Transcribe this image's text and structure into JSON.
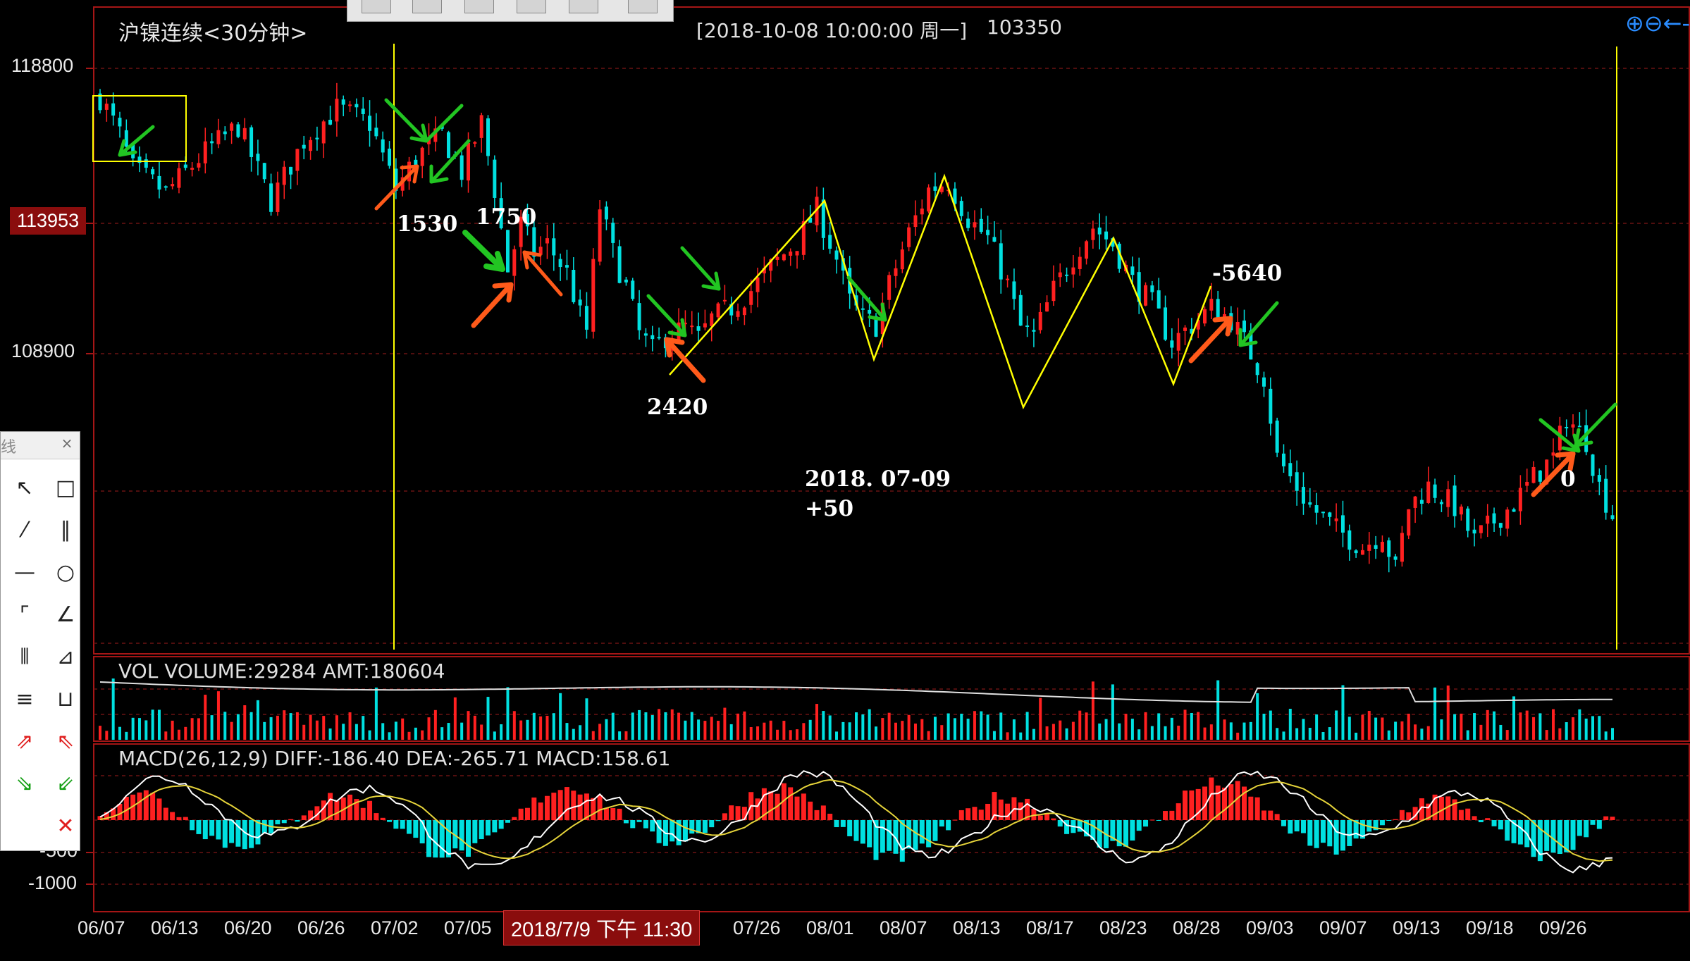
{
  "chart_title": "沪镍连续<30分钟>",
  "cursor_info": {
    "datetime": "[2018-10-08  10:00:00 周一]",
    "value": "103350"
  },
  "price_axis": {
    "labels": [
      "118800",
      "108900"
    ],
    "current_price": "113953"
  },
  "annotations": {
    "a1": "1530",
    "a2": "1750",
    "a3": "2420",
    "a4": "-5640",
    "a5": "0",
    "a6_line1": "2018. 07-09",
    "a6_line2": "+50"
  },
  "volume_panel": {
    "header": "VOL  VOLUME:29284 AMT:180604"
  },
  "macd_panel": {
    "header": "MACD(26,12,9)  DIFF:-186.40 DEA:-265.71 MACD:158.61",
    "axis_labels": [
      "-500",
      "-1000"
    ]
  },
  "date_axis": [
    "06/07",
    "06/13",
    "06/20",
    "06/26",
    "07/02",
    "07/05",
    "07/26",
    "08/01",
    "08/07",
    "08/13",
    "08/17",
    "08/23",
    "08/28",
    "09/03",
    "09/07",
    "09/13",
    "09/18",
    "09/26"
  ],
  "cursor_date_label": "2018/7/9 下午 11:30",
  "toolbox": {
    "title": "线"
  },
  "colors": {
    "up": "#ff2020",
    "down": "#00e0e0",
    "zigzag": "#ffff00",
    "green_arrow": "#22c522",
    "orange_arrow": "#ff5a1a"
  },
  "chart_data": {
    "type": "candlestick",
    "price_waypoints": [
      [
        0,
        117800
      ],
      [
        3,
        116500
      ],
      [
        5,
        115300
      ],
      [
        10,
        114500
      ],
      [
        16,
        115900
      ],
      [
        21,
        116800
      ],
      [
        26,
        114200
      ],
      [
        31,
        116300
      ],
      [
        36,
        117400
      ],
      [
        41,
        116900
      ],
      [
        45,
        114600
      ],
      [
        48,
        115700
      ],
      [
        52,
        116500
      ],
      [
        55,
        115200
      ],
      [
        58,
        116900
      ],
      [
        60,
        114600
      ],
      [
        62,
        111800
      ],
      [
        64,
        113400
      ],
      [
        66,
        112400
      ],
      [
        68,
        112700
      ],
      [
        71,
        111700
      ],
      [
        73,
        110200
      ],
      [
        74,
        109700
      ],
      [
        76,
        114000
      ],
      [
        78,
        112400
      ],
      [
        80,
        111200
      ],
      [
        82,
        109600
      ],
      [
        84,
        109000
      ],
      [
        86,
        109500
      ],
      [
        89,
        109800
      ],
      [
        91,
        109400
      ],
      [
        93,
        110100
      ],
      [
        96,
        110500
      ],
      [
        99,
        111100
      ],
      [
        102,
        111900
      ],
      [
        106,
        112800
      ],
      [
        109,
        113900
      ],
      [
        112,
        112200
      ],
      [
        114,
        110700
      ],
      [
        116,
        110100
      ],
      [
        118,
        109900
      ],
      [
        120,
        111300
      ],
      [
        123,
        113100
      ],
      [
        126,
        114600
      ],
      [
        129,
        114900
      ],
      [
        132,
        113600
      ],
      [
        135,
        112900
      ],
      [
        138,
        111300
      ],
      [
        140,
        109800
      ],
      [
        142,
        109500
      ],
      [
        145,
        111100
      ],
      [
        148,
        112300
      ],
      [
        151,
        113300
      ],
      [
        154,
        112700
      ],
      [
        157,
        111400
      ],
      [
        160,
        110600
      ],
      [
        163,
        109300
      ],
      [
        166,
        109900
      ],
      [
        169,
        110500
      ],
      [
        172,
        110100
      ],
      [
        175,
        108900
      ],
      [
        177,
        108100
      ],
      [
        179,
        105300
      ],
      [
        181,
        104600
      ],
      [
        184,
        103600
      ],
      [
        188,
        102800
      ],
      [
        192,
        102200
      ],
      [
        195,
        102700
      ],
      [
        197,
        101400
      ],
      [
        199,
        103600
      ],
      [
        202,
        104300
      ],
      [
        206,
        103600
      ],
      [
        209,
        102400
      ],
      [
        212,
        103100
      ],
      [
        215,
        103700
      ],
      [
        218,
        104600
      ],
      [
        221,
        105300
      ],
      [
        223,
        106700
      ],
      [
        226,
        105900
      ],
      [
        228,
        104300
      ],
      [
        230,
        103300
      ]
    ],
    "candle_count": 231,
    "volume_bars": 231,
    "macd_series": [
      "DIFF",
      "DEA",
      "MACD"
    ]
  }
}
